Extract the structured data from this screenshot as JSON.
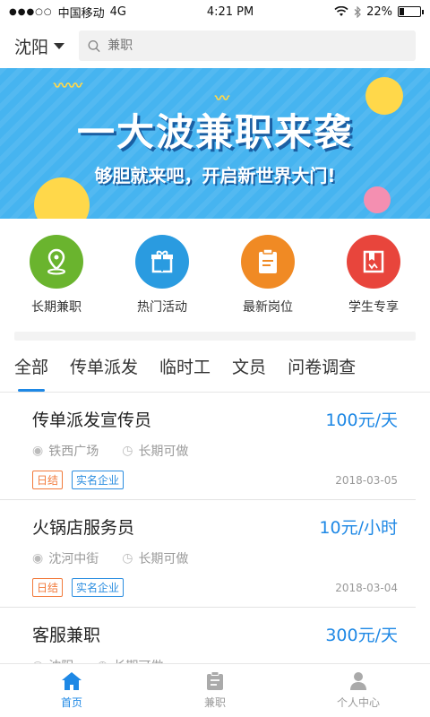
{
  "status": {
    "carrier": "中国移动",
    "network": "4G",
    "time": "4:21 PM",
    "battery": "22%",
    "battery_level": 0.22
  },
  "header": {
    "city": "沈阳",
    "search_placeholder": "兼职"
  },
  "banner": {
    "headline": "一大波兼职来袭",
    "subline": "够胆就来吧，开启新世界大门!"
  },
  "shortcuts": [
    {
      "label": "长期兼职",
      "icon": "location-pin-icon",
      "color": "#6ab42e"
    },
    {
      "label": "热门活动",
      "icon": "gift-icon",
      "color": "#2a9be0"
    },
    {
      "label": "最新岗位",
      "icon": "clipboard-icon",
      "color": "#f08a24"
    },
    {
      "label": "学生专享",
      "icon": "book-icon",
      "color": "#e8453c"
    }
  ],
  "tabs": [
    "全部",
    "传单派发",
    "临时工",
    "文员",
    "问卷调查"
  ],
  "jobs": [
    {
      "title": "传单派发宣传员",
      "pay": "100元/天",
      "location": "铁西广场",
      "term": "长期可做",
      "tags": [
        "日结",
        "实名企业"
      ],
      "date": "2018-03-05"
    },
    {
      "title": "火锅店服务员",
      "pay": "10元/小时",
      "location": "沈河中街",
      "term": "长期可做",
      "tags": [
        "日结",
        "实名企业"
      ],
      "date": "2018-03-04"
    },
    {
      "title": "客服兼职",
      "pay": "300元/天",
      "location": "沈阳",
      "term": "长期可做"
    }
  ],
  "tabbar": [
    {
      "label": "首页",
      "icon": "home-icon"
    },
    {
      "label": "兼职",
      "icon": "clipboard-icon"
    },
    {
      "label": "个人中心",
      "icon": "person-icon"
    }
  ],
  "colors": {
    "accent": "#1e88e5",
    "banner": "#46b4f0"
  }
}
